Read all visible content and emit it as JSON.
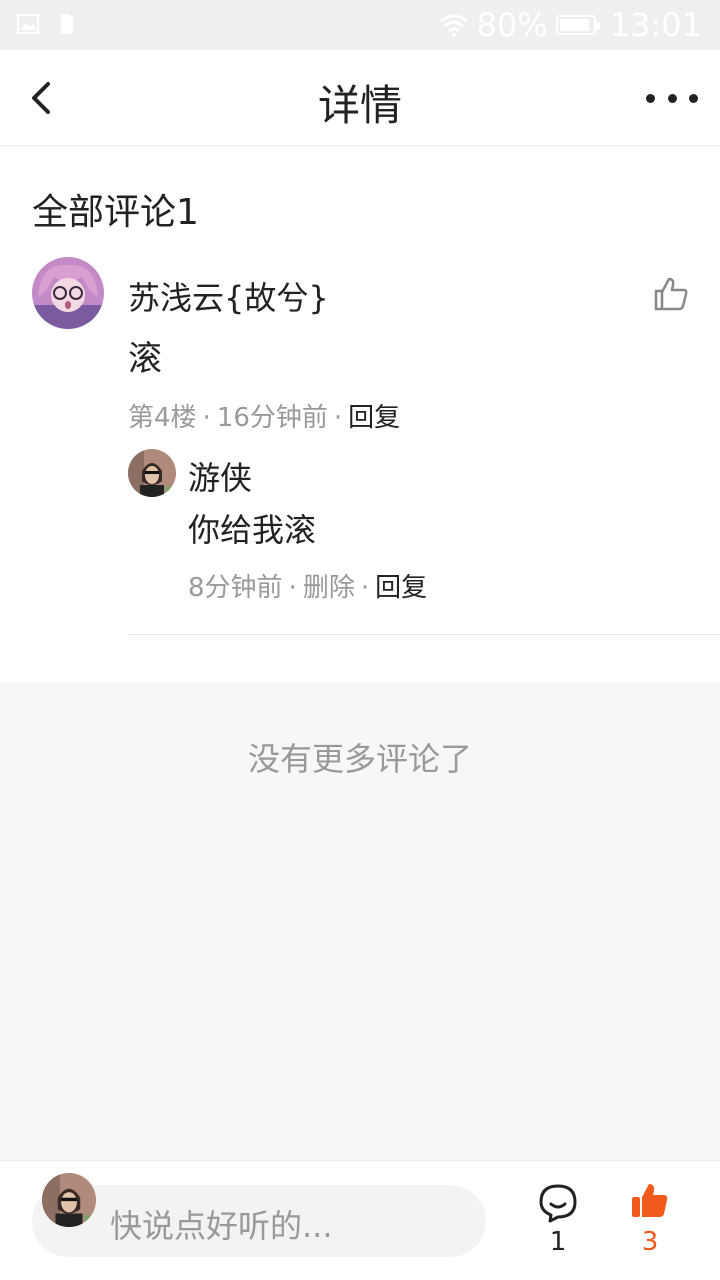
{
  "status_bar": {
    "battery": "80%",
    "time": "13:01",
    "battery_level": 0.8
  },
  "nav": {
    "title": "详情"
  },
  "section": {
    "title": "全部评论1"
  },
  "comment": {
    "author": "苏浅云{故兮}",
    "text": "滚",
    "floor": "第4楼",
    "time": "16分钟前",
    "reply_label": "回复"
  },
  "reply": {
    "author": "游侠",
    "text": "你给我滚",
    "time": "8分钟前",
    "delete_label": "删除",
    "reply_label": "回复"
  },
  "end_note": "没有更多评论了",
  "bottom": {
    "placeholder": "快说点好听的...",
    "comment_count": "1",
    "like_count": "3"
  },
  "colors": {
    "accent": "#f25a1c",
    "text": "#222222",
    "muted": "#999999",
    "background": "#f7f7f7"
  },
  "icons": [
    "image-icon",
    "sim-icon",
    "wifi-icon",
    "battery-icon",
    "back-icon",
    "more-icon",
    "thumbs-up-icon",
    "comment-icon",
    "thumbs-up-filled-icon"
  ]
}
